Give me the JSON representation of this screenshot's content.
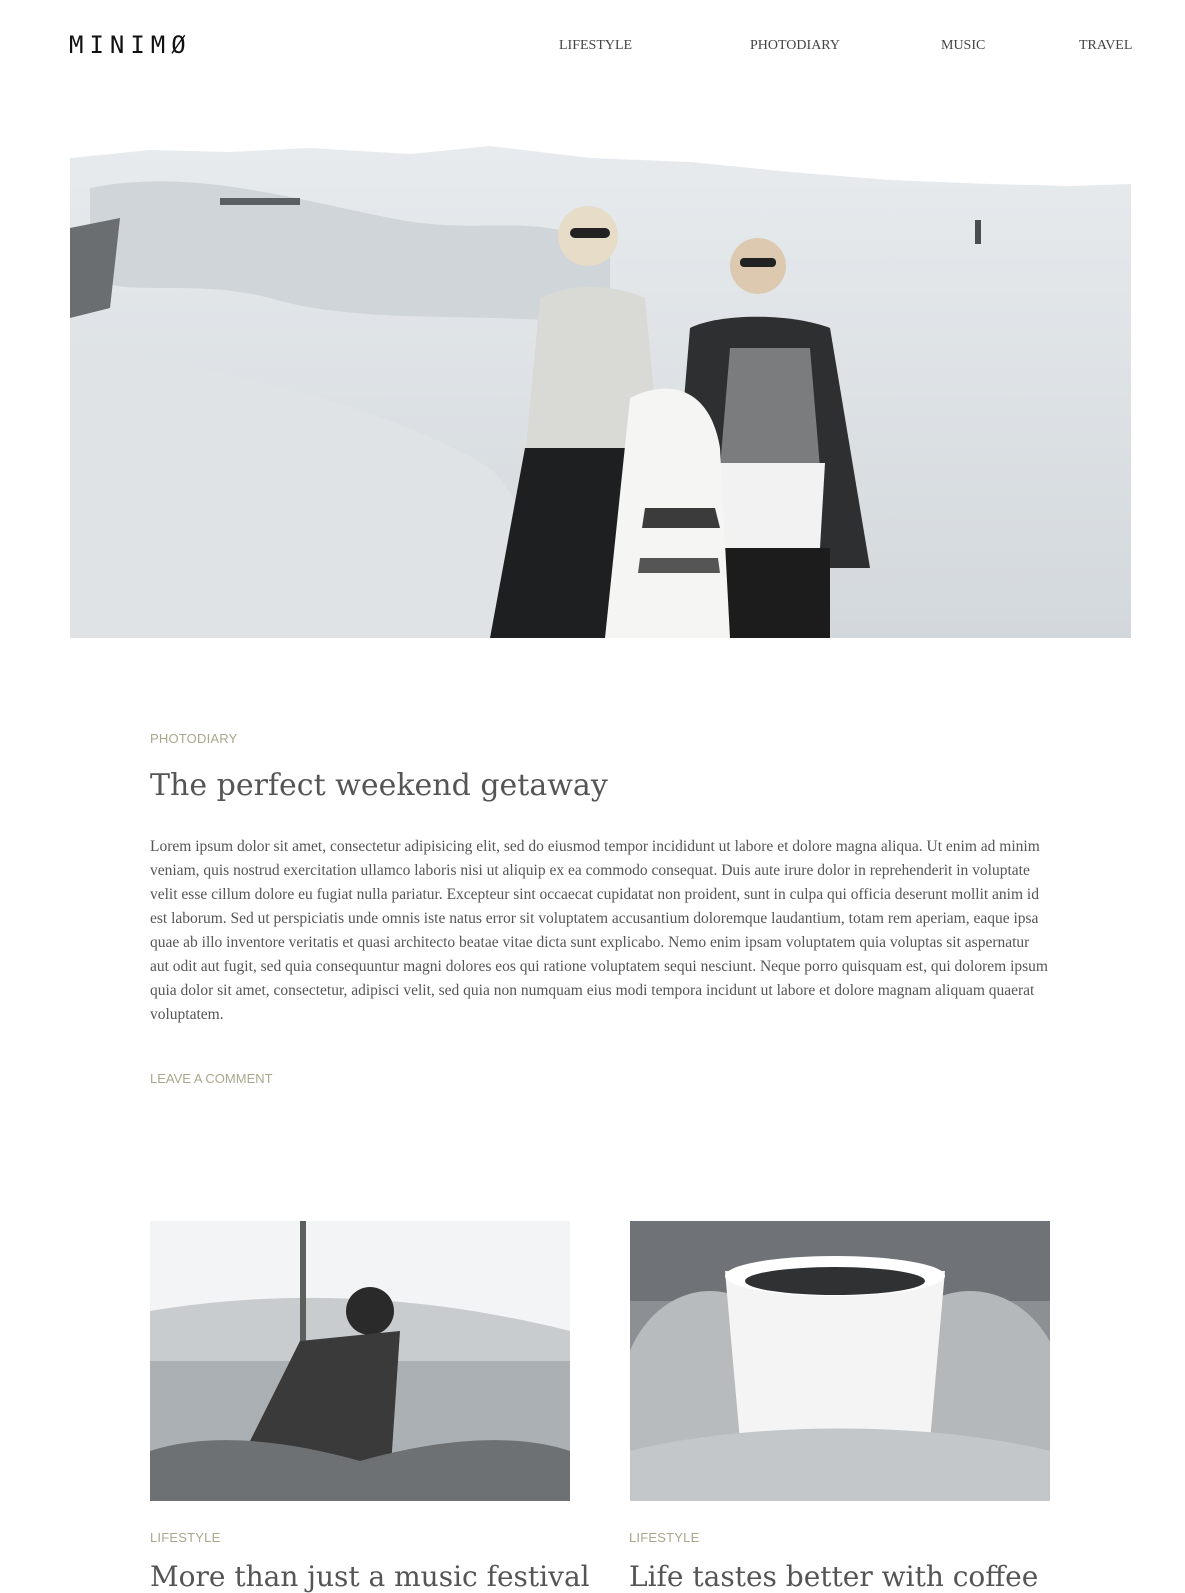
{
  "header": {
    "logo": "MINIMØ",
    "nav": [
      "LIFESTYLE",
      "PHOTODIARY",
      "MUSIC",
      "TRAVEL"
    ]
  },
  "featured": {
    "category": "PHOTODIARY",
    "title": "The perfect weekend getaway",
    "body": "Lorem ipsum dolor sit amet, consectetur adipisicing elit, sed do eiusmod tempor incididunt ut labore et dolore magna aliqua. Ut enim ad minim veniam, quis nostrud exercitation ullamco laboris nisi ut aliquip ex ea commodo consequat. Duis aute irure dolor in reprehenderit in voluptate velit esse cillum dolore eu fugiat nulla pariatur. Excepteur sint occaecat cupidatat non proident, sunt in culpa qui officia deserunt mollit anim id est laborum. Sed ut perspiciatis unde omnis iste natus error sit voluptatem accusantium doloremque laudantium, totam rem aperiam, eaque ipsa quae ab illo inventore veritatis et quasi architecto beatae vitae dicta sunt explicabo. Nemo enim ipsam voluptatem quia voluptas sit aspernatur aut odit aut fugit, sed quia consequuntur magni dolores eos qui ratione voluptatem sequi nesciunt. Neque porro quisquam est, qui dolorem ipsum quia dolor sit amet, consectetur, adipisci velit, sed quia non numquam eius modi tempora incidunt ut labore et dolore magnam aliquam quaerat voluptatem.",
    "comment_link": "LEAVE A COMMENT"
  },
  "posts": [
    {
      "category": "LIFESTYLE",
      "title": "More than just a music festival"
    },
    {
      "category": "LIFESTYLE",
      "title": "Life tastes better with coffee"
    }
  ]
}
